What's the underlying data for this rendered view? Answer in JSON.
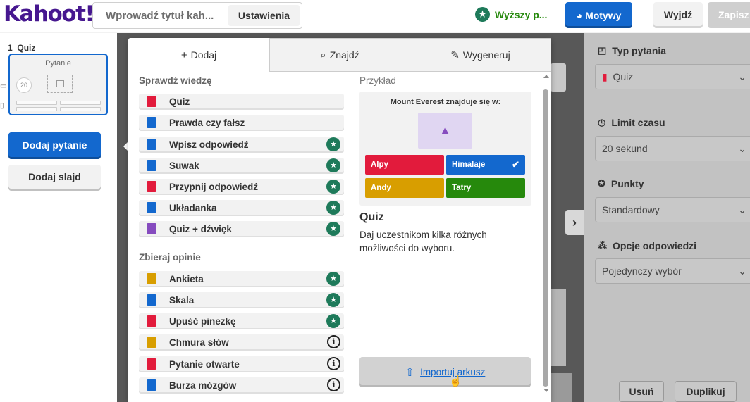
{
  "header": {
    "logo": "Kahoot!",
    "title_placeholder": "Wprowadź tytuł kah...",
    "settings_label": "Ustawienia",
    "upgrade_label": "Wyższy p...",
    "themes_label": "Motywy",
    "exit_label": "Wyjdź",
    "save_label": "Zapisz"
  },
  "sidebar": {
    "slide_number": "1",
    "slide_type": "Quiz",
    "thumb_title": "Pytanie",
    "thumb_timer": "20",
    "add_question": "Dodaj pytanie",
    "add_slide": "Dodaj slajd"
  },
  "modal": {
    "tabs": [
      {
        "icon": "+",
        "label": "Dodaj"
      },
      {
        "icon": "⌕",
        "label": "Znajdź"
      },
      {
        "icon": "✎",
        "label": "Wygeneruj"
      }
    ],
    "groups": [
      {
        "title": "Sprawdź wiedzę",
        "items": [
          {
            "label": "Quiz",
            "badge": "",
            "color": "#e21b3c"
          },
          {
            "label": "Prawda czy fałsz",
            "badge": "",
            "color": "#1368ce"
          },
          {
            "label": "Wpisz odpowiedź",
            "badge": "star",
            "color": "#1368ce"
          },
          {
            "label": "Suwak",
            "badge": "star",
            "color": "#1368ce"
          },
          {
            "label": "Przypnij odpowiedź",
            "badge": "star",
            "color": "#e21b3c"
          },
          {
            "label": "Układanka",
            "badge": "star",
            "color": "#1368ce"
          },
          {
            "label": "Quiz + dźwięk",
            "badge": "star",
            "color": "#864cbf"
          }
        ]
      },
      {
        "title": "Zbieraj opinie",
        "items": [
          {
            "label": "Ankieta",
            "badge": "star",
            "color": "#d89e00"
          },
          {
            "label": "Skala",
            "badge": "star",
            "color": "#1368ce"
          },
          {
            "label": "Upuść pinezkę",
            "badge": "star",
            "color": "#e21b3c"
          },
          {
            "label": "Chmura słów",
            "badge": "info",
            "color": "#d89e00"
          },
          {
            "label": "Pytanie otwarte",
            "badge": "info",
            "color": "#e21b3c"
          },
          {
            "label": "Burza mózgów",
            "badge": "info",
            "color": "#1368ce"
          }
        ]
      }
    ],
    "example": {
      "label": "Przykład",
      "question": "Mount Everest znajduje się w:",
      "answers": [
        {
          "label": "Alpy",
          "color": "#e21b3c",
          "correct": false
        },
        {
          "label": "Himalaje",
          "color": "#1368ce",
          "correct": true
        },
        {
          "label": "Andy",
          "color": "#d89e00",
          "correct": false
        },
        {
          "label": "Tatry",
          "color": "#26890c",
          "correct": false
        }
      ],
      "title": "Quiz",
      "description": "Daj uczestnikom kilka różnych możliwości do wyboru."
    },
    "import_label": "Importuj arkusz"
  },
  "right_panel": {
    "question_type_label": "Typ pytania",
    "question_type_value": "Quiz",
    "time_limit_label": "Limit czasu",
    "time_limit_value": "20 sekund",
    "points_label": "Punkty",
    "points_value": "Standardowy",
    "answer_options_label": "Opcje odpowiedzi",
    "answer_options_value": "Pojedynczy wybór",
    "delete_label": "Usuń",
    "duplicate_label": "Duplikuj"
  }
}
